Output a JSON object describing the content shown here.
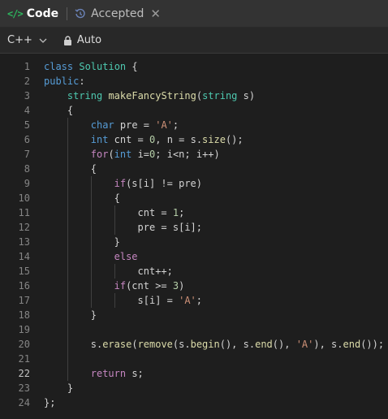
{
  "tabs": [
    {
      "label": "Code",
      "icon": "code-brackets-icon"
    },
    {
      "label": "Accepted",
      "icon": "history-icon"
    }
  ],
  "toolbar": {
    "language": "C++",
    "mode": "Auto"
  },
  "editor": {
    "active_line": 22,
    "lines": [
      {
        "n": "1",
        "indent": 0,
        "t": [
          [
            "kw",
            "class "
          ],
          [
            "ty",
            "Solution"
          ],
          [
            "id",
            " {"
          ]
        ]
      },
      {
        "n": "2",
        "indent": 0,
        "t": [
          [
            "kw",
            "public"
          ],
          [
            "id",
            ":"
          ]
        ]
      },
      {
        "n": "3",
        "indent": 1,
        "t": [
          [
            "ty",
            "string "
          ],
          [
            "fn",
            "makeFancyString"
          ],
          [
            "id",
            "("
          ],
          [
            "ty",
            "string "
          ],
          [
            "id",
            "s)"
          ]
        ]
      },
      {
        "n": "4",
        "indent": 1,
        "t": [
          [
            "id",
            "{"
          ]
        ]
      },
      {
        "n": "5",
        "indent": 2,
        "t": [
          [
            "kw",
            "char "
          ],
          [
            "id",
            "pre = "
          ],
          [
            "str",
            "'A'"
          ],
          [
            "id",
            ";"
          ]
        ]
      },
      {
        "n": "6",
        "indent": 2,
        "t": [
          [
            "kw",
            "int "
          ],
          [
            "id",
            "cnt = "
          ],
          [
            "num",
            "0"
          ],
          [
            "id",
            ", n = s."
          ],
          [
            "fn",
            "size"
          ],
          [
            "id",
            "();"
          ]
        ]
      },
      {
        "n": "7",
        "indent": 2,
        "t": [
          [
            "ctl",
            "for"
          ],
          [
            "id",
            "("
          ],
          [
            "kw",
            "int "
          ],
          [
            "id",
            "i="
          ],
          [
            "num",
            "0"
          ],
          [
            "id",
            "; i<n; i++)"
          ]
        ]
      },
      {
        "n": "8",
        "indent": 2,
        "t": [
          [
            "id",
            "{"
          ]
        ]
      },
      {
        "n": "9",
        "indent": 3,
        "t": [
          [
            "ctl",
            "if"
          ],
          [
            "id",
            "(s[i] != pre)"
          ]
        ]
      },
      {
        "n": "10",
        "indent": 3,
        "t": [
          [
            "id",
            "{"
          ]
        ]
      },
      {
        "n": "11",
        "indent": 4,
        "t": [
          [
            "id",
            "cnt = "
          ],
          [
            "num",
            "1"
          ],
          [
            "id",
            ";"
          ]
        ]
      },
      {
        "n": "12",
        "indent": 4,
        "t": [
          [
            "id",
            "pre = s[i];"
          ]
        ]
      },
      {
        "n": "13",
        "indent": 3,
        "t": [
          [
            "id",
            "}"
          ]
        ]
      },
      {
        "n": "14",
        "indent": 3,
        "t": [
          [
            "ctl",
            "else"
          ]
        ]
      },
      {
        "n": "15",
        "indent": 4,
        "t": [
          [
            "id",
            "cnt++;"
          ]
        ]
      },
      {
        "n": "16",
        "indent": 3,
        "t": [
          [
            "ctl",
            "if"
          ],
          [
            "id",
            "(cnt >= "
          ],
          [
            "num",
            "3"
          ],
          [
            "id",
            ")"
          ]
        ]
      },
      {
        "n": "17",
        "indent": 4,
        "t": [
          [
            "id",
            "s[i] = "
          ],
          [
            "str",
            "'A'"
          ],
          [
            "id",
            ";"
          ]
        ]
      },
      {
        "n": "18",
        "indent": 2,
        "t": [
          [
            "id",
            "}"
          ]
        ]
      },
      {
        "n": "19",
        "indent": 2,
        "t": []
      },
      {
        "n": "20",
        "indent": 2,
        "t": [
          [
            "id",
            "s."
          ],
          [
            "fn",
            "erase"
          ],
          [
            "id",
            "("
          ],
          [
            "fn",
            "remove"
          ],
          [
            "id",
            "(s."
          ],
          [
            "fn",
            "begin"
          ],
          [
            "id",
            "(), s."
          ],
          [
            "fn",
            "end"
          ],
          [
            "id",
            "(), "
          ],
          [
            "str",
            "'A'"
          ],
          [
            "id",
            "), s."
          ],
          [
            "fn",
            "end"
          ],
          [
            "id",
            "());"
          ]
        ]
      },
      {
        "n": "21",
        "indent": 2,
        "t": []
      },
      {
        "n": "22",
        "indent": 2,
        "t": [
          [
            "ctl",
            "return "
          ],
          [
            "id",
            "s;"
          ]
        ]
      },
      {
        "n": "23",
        "indent": 1,
        "t": [
          [
            "id",
            "}"
          ]
        ]
      },
      {
        "n": "24",
        "indent": 0,
        "t": [
          [
            "id",
            "};"
          ]
        ]
      }
    ]
  }
}
